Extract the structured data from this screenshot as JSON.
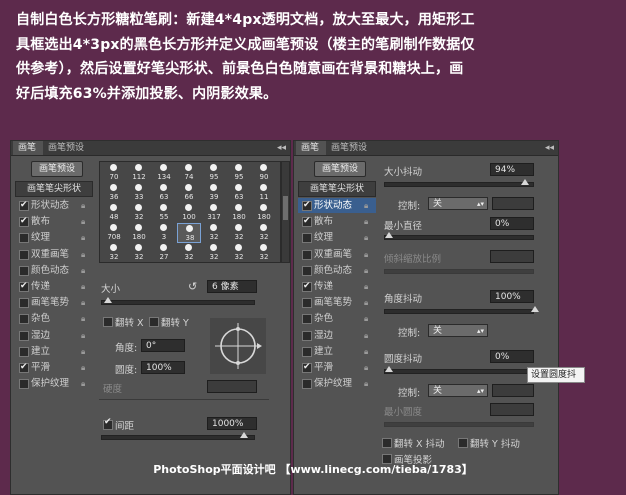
{
  "caption": {
    "line1": "自制白色长方形糖粒笔刷：新建4*4px透明文档，放大至最大，用矩形工",
    "line2": "具框选出4*3px的黑色长方形并定义成画笔预设（楼主的笔刷制作数据仅",
    "line3": "供参考），然后设置好笔尖形状、前景色白色随意画在背景和糖块上，画",
    "line4": "好后填充63%并添加投影、内阴影效果。"
  },
  "left_panel": {
    "tab_brush": "画笔",
    "tab_presets": "画笔预设",
    "collapse": "◂◂",
    "preset_button": "画笔预设",
    "tip_shape": "画笔笔尖形状",
    "options": [
      {
        "label": "形状动态",
        "checked": "✔"
      },
      {
        "label": "散布",
        "checked": "✔"
      },
      {
        "label": "纹理",
        "checked": ""
      },
      {
        "label": "双重画笔",
        "checked": ""
      },
      {
        "label": "颜色动态",
        "checked": ""
      },
      {
        "label": "传递",
        "checked": "✔"
      },
      {
        "label": "画笔笔势",
        "checked": ""
      },
      {
        "label": "杂色",
        "checked": ""
      },
      {
        "label": "湿边",
        "checked": ""
      },
      {
        "label": "建立",
        "checked": ""
      },
      {
        "label": "平滑",
        "checked": "✔"
      },
      {
        "label": "保护纹理",
        "checked": ""
      }
    ],
    "brush_sizes": [
      "70",
      "112",
      "134",
      "74",
      "95",
      "95",
      "90",
      "36",
      "33",
      "63",
      "66",
      "39",
      "63",
      "11",
      "48",
      "32",
      "55",
      "100",
      "317",
      "180",
      "180",
      "708",
      "180",
      "3",
      "38",
      "32",
      "32",
      "32",
      "32",
      "32",
      "27",
      "32",
      "32",
      "32",
      "32"
    ],
    "size_label": "大小",
    "size_value": "6 像素",
    "flip_x": "翻转 X",
    "flip_y": "翻转 Y",
    "angle_label": "角度:",
    "angle_value": "0°",
    "roundness_label": "圆度:",
    "roundness_value": "100%",
    "hardness_label": "硬度",
    "spacing_label": "间距",
    "spacing_value": "1000%"
  },
  "right_panel": {
    "tab_brush": "画笔",
    "tab_presets": "画笔预设",
    "preset_button": "画笔预设",
    "tip_shape": "画笔笔尖形状",
    "options": [
      {
        "label": "形状动态",
        "checked": "✔"
      },
      {
        "label": "散布",
        "checked": "✔"
      },
      {
        "label": "纹理",
        "checked": ""
      },
      {
        "label": "双重画笔",
        "checked": ""
      },
      {
        "label": "颜色动态",
        "checked": ""
      },
      {
        "label": "传递",
        "checked": "✔"
      },
      {
        "label": "画笔笔势",
        "checked": ""
      },
      {
        "label": "杂色",
        "checked": ""
      },
      {
        "label": "湿边",
        "checked": ""
      },
      {
        "label": "建立",
        "checked": ""
      },
      {
        "label": "平滑",
        "checked": "✔"
      },
      {
        "label": "保护纹理",
        "checked": ""
      }
    ],
    "size_jitter_label": "大小抖动",
    "size_jitter_value": "94%",
    "control_label": "控制:",
    "control_value": "关",
    "min_diameter_label": "最小直径",
    "min_diameter_value": "0%",
    "tilt_scale_label": "倾斜缩放比例",
    "angle_jitter_label": "角度抖动",
    "angle_jitter_value": "100%",
    "control2_label": "控制:",
    "control2_value": "关",
    "roundness_jitter_label": "圆度抖动",
    "roundness_jitter_value": "0%",
    "control3_label": "控制:",
    "control3_value": "关",
    "min_roundness_label": "最小圆度",
    "flip_x_jitter": "翻转 X 抖动",
    "flip_y_jitter": "翻转 Y 抖动",
    "brush_projection": "画笔投影",
    "tooltip": "设置圆度抖"
  },
  "footer": "PhotoShop平面设计吧  【www.linecg.com/tieba/1783】"
}
